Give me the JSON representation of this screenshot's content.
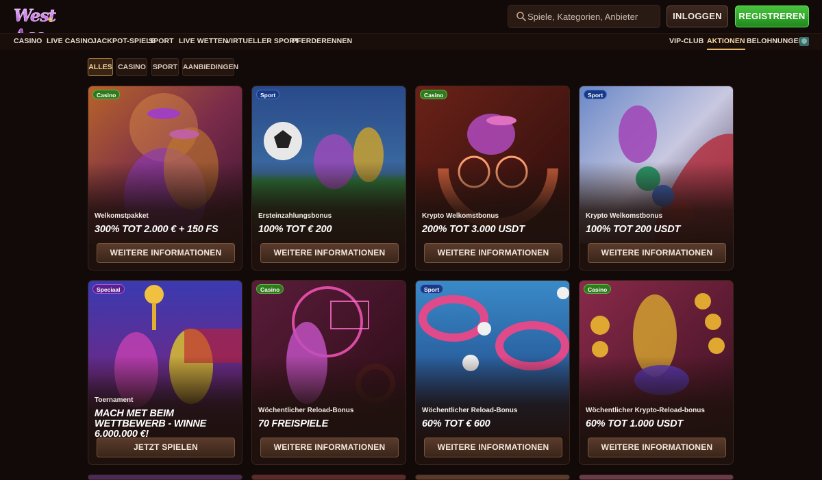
{
  "brand": {
    "logo_text": "West Ace",
    "logo_icon": "spade-icon"
  },
  "header": {
    "search_placeholder": "Spiele, Kategorien, Anbieter",
    "login_label": "INLOGGEN",
    "register_label": "REGISTREREN"
  },
  "nav": {
    "left": [
      "CASINO",
      "LIVE CASINO",
      "JACKPOT-SPIELE",
      "SPORT",
      "LIVE WETTEN",
      "VIRTUELLER SPORT",
      "PFERDERENNEN"
    ],
    "right": [
      "VIP-CLUB",
      "AKTIONEN",
      "BELOHNUNGEN"
    ],
    "active": "AKTIONEN"
  },
  "filters": {
    "items": [
      "ALLES",
      "CASINO",
      "SPORT",
      "AANBIEDINGEN"
    ],
    "active": "ALLES"
  },
  "cards": [
    {
      "badge": "Casino",
      "subtitle": "Welkomstpakket",
      "title": "300% TOT 2.000 € + 150 FS",
      "button": "WEITERE INFORMATIONEN"
    },
    {
      "badge": "Sport",
      "subtitle": "Ersteinzahlungsbonus",
      "title": "100% TOT € 200",
      "button": "WEITERE INFORMATIONEN"
    },
    {
      "badge": "Casino",
      "subtitle": "Krypto Welkomstbonus",
      "title": "200% TOT 3.000 USDT",
      "button": "WEITERE INFORMATIONEN"
    },
    {
      "badge": "Sport",
      "subtitle": "Krypto Welkomstbonus",
      "title": "100% TOT 200 USDT",
      "button": "WEITERE INFORMATIONEN"
    },
    {
      "badge": "Speciaal",
      "subtitle": "Toernament",
      "title": "MACH MET BEIM WETTBEWERB - WINNE 6.000.000 €!",
      "button": "JETZT SPIELEN"
    },
    {
      "badge": "Casino",
      "subtitle": "Wöchentlicher Reload-Bonus",
      "title": "70 FREISPIELE",
      "button": "WEITERE INFORMATIONEN"
    },
    {
      "badge": "Sport",
      "subtitle": "Wöchentlicher Reload-Bonus",
      "title": "60% TOT € 600",
      "button": "WEITERE INFORMATIONEN"
    },
    {
      "badge": "Casino",
      "subtitle": "Wöchentlicher Krypto-Reload-bonus",
      "title": "60% TOT 1.000 USDT",
      "button": "WEITERE INFORMATIONEN"
    }
  ],
  "colors": {
    "accent": "#e8b96a",
    "register_green": "#2fa52a",
    "background": "#120909"
  }
}
